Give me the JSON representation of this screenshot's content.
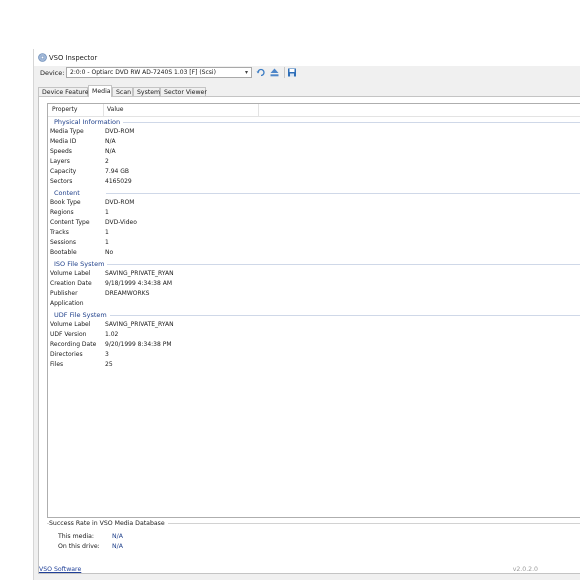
{
  "window": {
    "title": "VSO Inspector"
  },
  "toolbar": {
    "device_label": "Device:",
    "device_value": "2:0:0 - Optiarc DVD RW AD-7240S 1.03 [F] (Scsi)",
    "buttons": [
      "refresh-icon",
      "eject-icon",
      "save-icon"
    ]
  },
  "tabs": [
    {
      "label": "Device Features",
      "active": false
    },
    {
      "label": "Media",
      "active": true
    },
    {
      "label": "Scan",
      "active": false
    },
    {
      "label": "System",
      "active": false
    },
    {
      "label": "Sector Viewer",
      "active": false
    }
  ],
  "columns": {
    "property": "Property",
    "value": "Value"
  },
  "groups": [
    {
      "name": "Physical Information",
      "rows": [
        {
          "property": "Media Type",
          "value": "DVD-ROM"
        },
        {
          "property": "Media ID",
          "value": "N/A"
        },
        {
          "property": "Speeds",
          "value": "N/A"
        },
        {
          "property": "Layers",
          "value": "2"
        },
        {
          "property": "Capacity",
          "value": "7.94 GB"
        },
        {
          "property": "Sectors",
          "value": "4165029"
        }
      ]
    },
    {
      "name": "Content",
      "rows": [
        {
          "property": "Book Type",
          "value": "DVD-ROM"
        },
        {
          "property": "Regions",
          "value": "1"
        },
        {
          "property": "Content Type",
          "value": "DVD-Video"
        },
        {
          "property": "Tracks",
          "value": "1"
        },
        {
          "property": "Sessions",
          "value": "1"
        },
        {
          "property": "Bootable",
          "value": "No"
        }
      ]
    },
    {
      "name": "ISO File System",
      "rows": [
        {
          "property": "Volume Label",
          "value": "SAVING_PRIVATE_RYAN"
        },
        {
          "property": "Creation Date",
          "value": "9/18/1999 4:34:38 AM"
        },
        {
          "property": "Publisher",
          "value": "DREAMWORKS"
        },
        {
          "property": "Application",
          "value": ""
        }
      ]
    },
    {
      "name": "UDF File System",
      "rows": [
        {
          "property": "Volume Label",
          "value": "SAVING_PRIVATE_RYAN"
        },
        {
          "property": "UDF Version",
          "value": "1.02"
        },
        {
          "property": "Recording Date",
          "value": "9/20/1999 8:34:38 PM"
        },
        {
          "property": "Directories",
          "value": "3"
        },
        {
          "property": "Files",
          "value": "25"
        }
      ]
    }
  ],
  "success_rate": {
    "title": "Success Rate in VSO Media Database",
    "this_media_label": "This media:",
    "this_media_value": "N/A",
    "on_drive_label": "On this drive:",
    "on_drive_value": "N/A"
  },
  "footer": {
    "link": "VSO Software",
    "version": "v2.0.2.0"
  },
  "colors": {
    "group_header": "#1e3f8a",
    "link": "#1f3f98",
    "window_bg": "#f0f0f0"
  }
}
